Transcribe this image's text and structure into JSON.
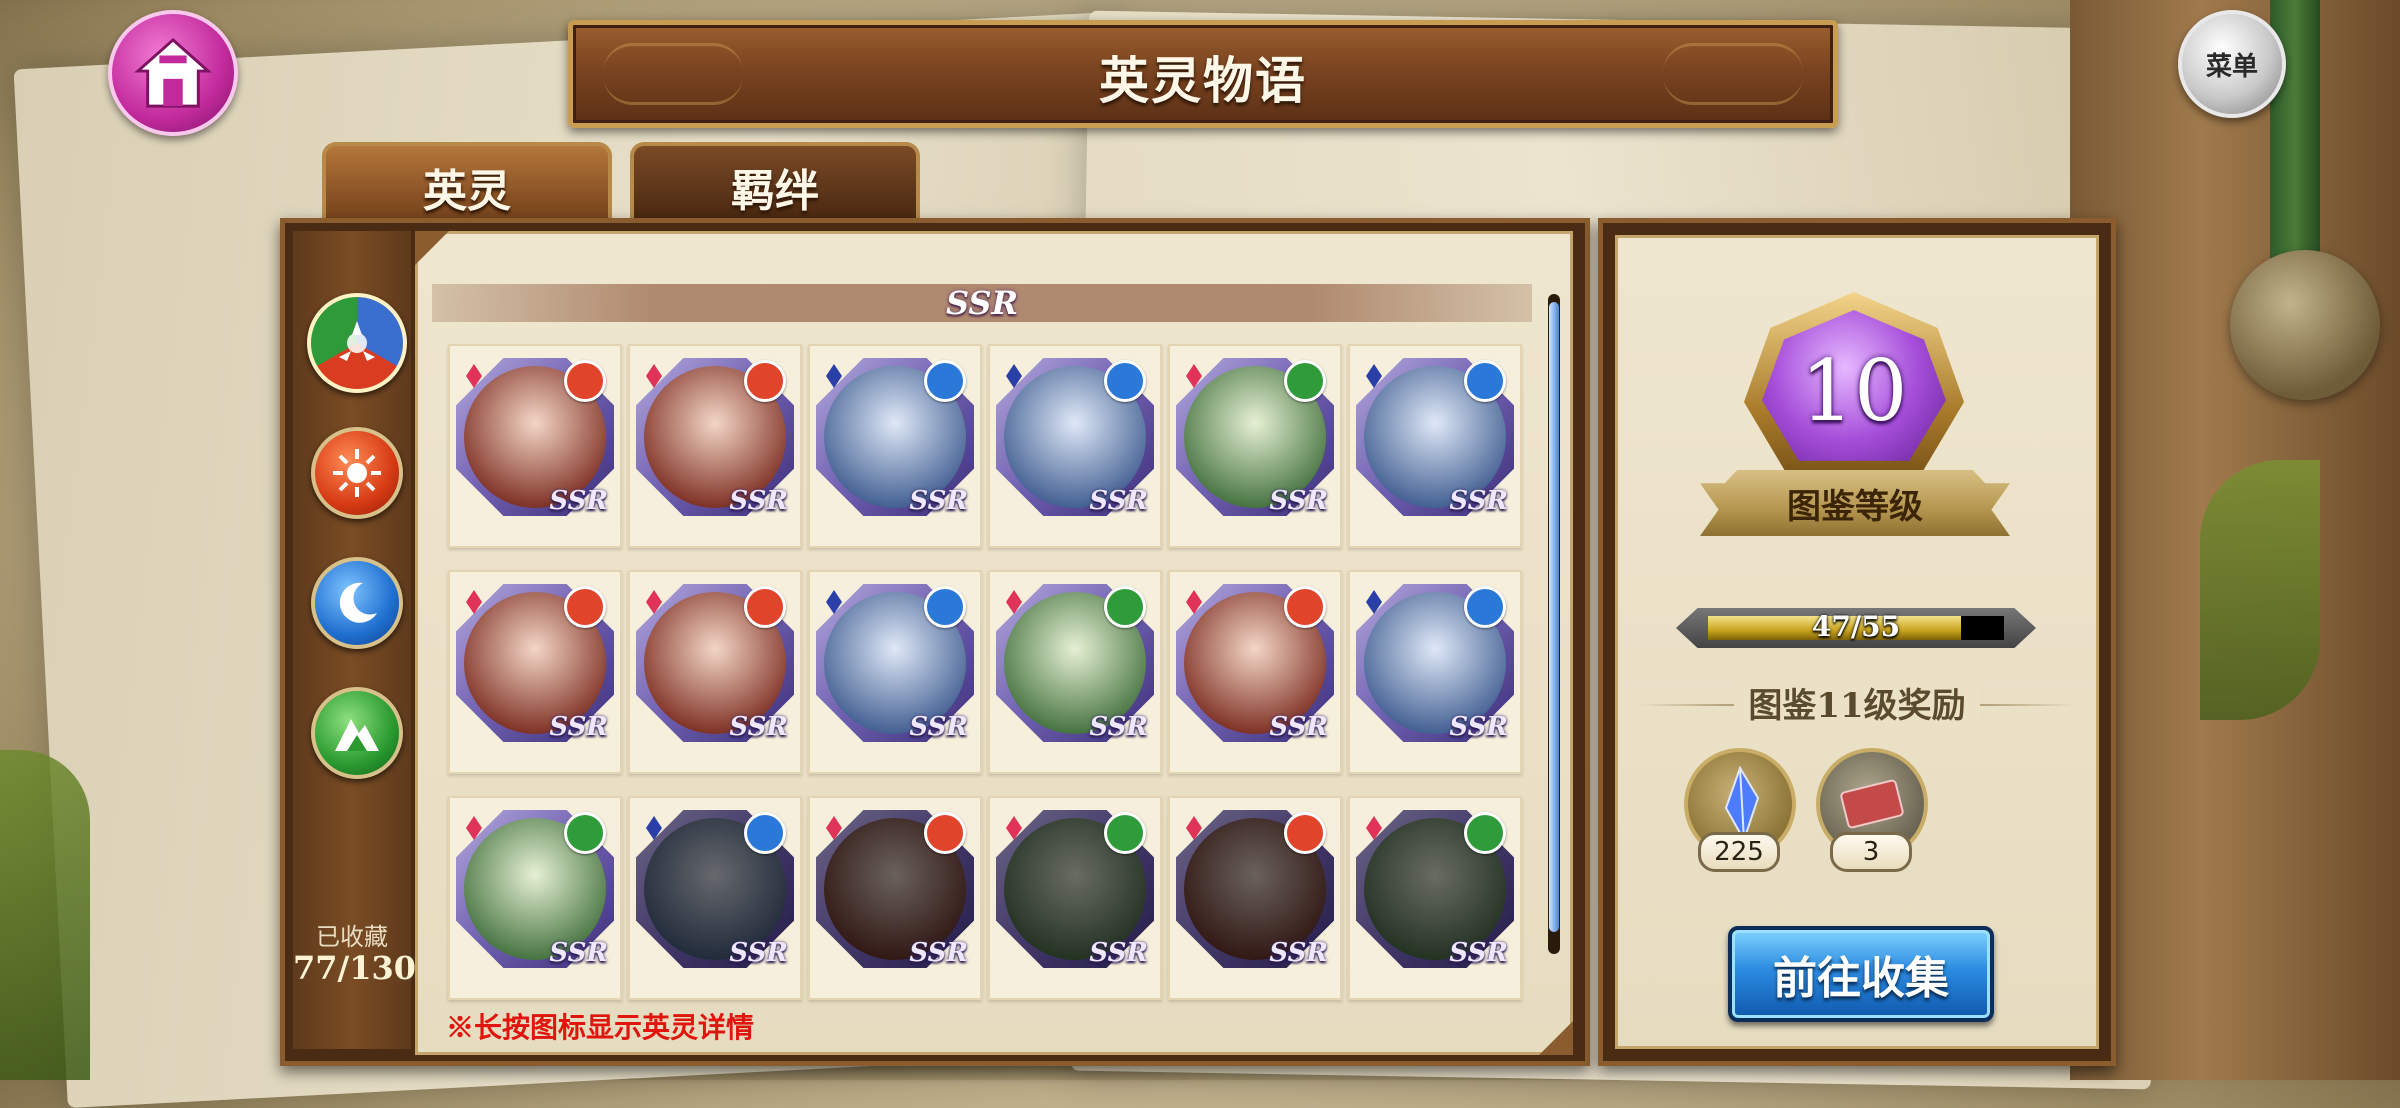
{
  "header": {
    "title": "英灵物语",
    "menu_label": "菜单"
  },
  "tabs": [
    {
      "label": "英灵",
      "active": true
    },
    {
      "label": "羁绊",
      "active": false
    }
  ],
  "sidebar": {
    "elements": [
      "all-elements-icon",
      "fire-icon",
      "water-icon",
      "wind-icon"
    ],
    "collected_label": "已收藏",
    "collected_count": "77/130"
  },
  "rarity_header": "SSR",
  "cards": [
    {
      "element": "fire",
      "locked": false,
      "rarity": "SSR"
    },
    {
      "element": "fire",
      "locked": false,
      "rarity": "SSR"
    },
    {
      "element": "water",
      "locked": false,
      "rarity": "SSR"
    },
    {
      "element": "water",
      "locked": false,
      "rarity": "SSR"
    },
    {
      "element": "wind",
      "locked": false,
      "rarity": "SSR"
    },
    {
      "element": "water",
      "locked": false,
      "rarity": "SSR"
    },
    {
      "element": "fire",
      "locked": false,
      "rarity": "SSR"
    },
    {
      "element": "fire",
      "locked": false,
      "rarity": "SSR"
    },
    {
      "element": "water",
      "locked": false,
      "rarity": "SSR"
    },
    {
      "element": "wind",
      "locked": false,
      "rarity": "SSR"
    },
    {
      "element": "fire",
      "locked": false,
      "rarity": "SSR"
    },
    {
      "element": "water",
      "locked": false,
      "rarity": "SSR"
    },
    {
      "element": "wind",
      "locked": false,
      "rarity": "SSR"
    },
    {
      "element": "water",
      "locked": true,
      "rarity": "SSR"
    },
    {
      "element": "fire",
      "locked": true,
      "rarity": "SSR"
    },
    {
      "element": "wind",
      "locked": true,
      "rarity": "SSR"
    },
    {
      "element": "fire",
      "locked": true,
      "rarity": "SSR"
    },
    {
      "element": "wind",
      "locked": true,
      "rarity": "SSR"
    }
  ],
  "hint": "※长按图标显示英灵详情",
  "codex": {
    "level": "10",
    "level_label": "图鉴等级",
    "progress_text": "47/55",
    "progress": {
      "current": 47,
      "max": 55
    },
    "reward_title": "图鉴11级奖励",
    "rewards": [
      {
        "icon": "crystal-icon",
        "count": "225"
      },
      {
        "icon": "ticket-icon",
        "count": "3"
      }
    ],
    "go_button": "前往收集"
  },
  "colors": {
    "fire": "#e0442a",
    "water": "#2a78d8",
    "wind": "#2f9b3a",
    "fire_diamond": "#e0335a",
    "water_diamond": "#2b3fa8",
    "wind_diamond": "#e0335a",
    "accent_blue": "#2b8be0"
  }
}
